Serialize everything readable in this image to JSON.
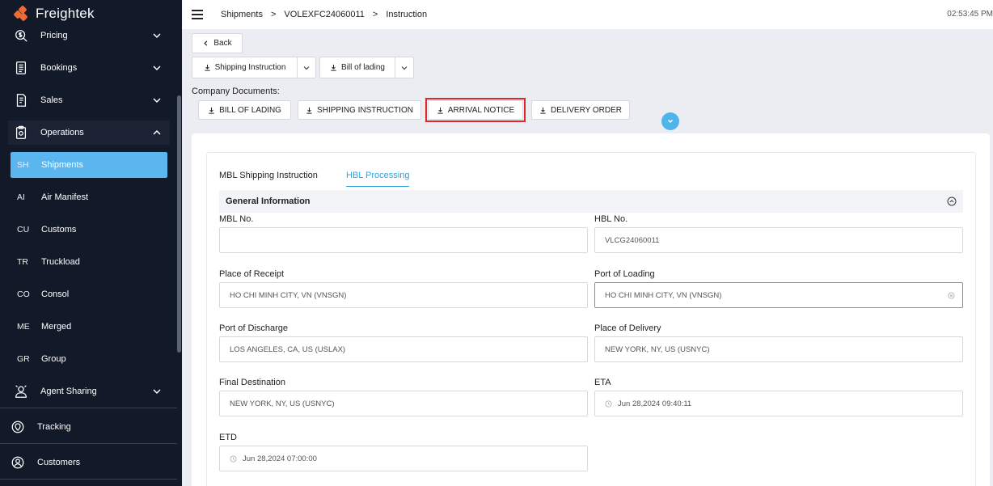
{
  "app": {
    "name": "Freightek"
  },
  "sidebar": {
    "items": [
      {
        "label": "Pricing",
        "icon": "pricing-icon"
      },
      {
        "label": "Bookings",
        "icon": "bookings-icon"
      },
      {
        "label": "Sales",
        "icon": "sales-icon"
      },
      {
        "label": "Operations",
        "icon": "operations-icon"
      }
    ],
    "sub_items": [
      {
        "abbr": "SH",
        "label": "Shipments"
      },
      {
        "abbr": "AI",
        "label": "Air Manifest"
      },
      {
        "abbr": "CU",
        "label": "Customs"
      },
      {
        "abbr": "TR",
        "label": "Truckload"
      },
      {
        "abbr": "CO",
        "label": "Consol"
      },
      {
        "abbr": "ME",
        "label": "Merged"
      },
      {
        "abbr": "GR",
        "label": "Group"
      }
    ],
    "agent_sharing": "Agent Sharing",
    "tracking": "Tracking",
    "customers": "Customers"
  },
  "breadcrumb": {
    "items": [
      "Shipments",
      "VOLEXFC24060011",
      "Instruction"
    ],
    "separator": ">"
  },
  "clock": "02:53:45 PM",
  "actions": {
    "back": "Back",
    "shipping_instruction": "Shipping Instruction",
    "bill_of_lading": "Bill of lading"
  },
  "company_documents": {
    "label": "Company Documents:",
    "buttons": [
      "BILL OF LADING",
      "SHIPPING INSTRUCTION",
      "ARRIVAL NOTICE",
      "DELIVERY ORDER"
    ]
  },
  "tabs": [
    "MBL Shipping Instruction",
    "HBL Processing"
  ],
  "active_tab": "HBL Processing",
  "section": {
    "title": "General Information"
  },
  "fields": {
    "mbl_no": {
      "label": "MBL No.",
      "value": ""
    },
    "hbl_no": {
      "label": "HBL No.",
      "value": "VLCG24060011"
    },
    "place_of_receipt": {
      "label": "Place of Receipt",
      "value": "HO CHI MINH CITY, VN (VNSGN)"
    },
    "port_of_loading": {
      "label": "Port of Loading",
      "value": "HO CHI MINH CITY, VN (VNSGN)"
    },
    "port_of_discharge": {
      "label": "Port of Discharge",
      "value": "LOS ANGELES, CA, US (USLAX)"
    },
    "place_of_delivery": {
      "label": "Place of Delivery",
      "value": "NEW YORK, NY, US (USNYC)"
    },
    "final_destination": {
      "label": "Final Destination",
      "value": "NEW YORK, NY, US (USNYC)"
    },
    "eta": {
      "label": "ETA",
      "value": "Jun 28,2024 09:40:11"
    },
    "etd": {
      "label": "ETD",
      "value": "Jun 28,2024 07:00:00"
    }
  },
  "colors": {
    "sidebar_bg": "#121a2a",
    "accent": "#5bb6ef",
    "highlight": "#e02626",
    "brand": "#f26a32"
  }
}
